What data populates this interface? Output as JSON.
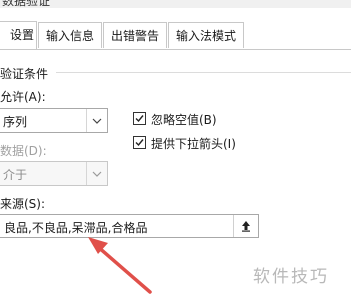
{
  "window": {
    "title": "数据验证"
  },
  "tabs": [
    {
      "label": "设置",
      "active": true
    },
    {
      "label": "输入信息",
      "active": false
    },
    {
      "label": "出错警告",
      "active": false
    },
    {
      "label": "输入法模式",
      "active": false
    }
  ],
  "validation": {
    "group_label": "验证条件",
    "allow_label": "允许(A):",
    "allow_value": "序列",
    "data_label": "数据(D):",
    "data_value": "介于",
    "ignore_blank_label": "忽略空值(B)",
    "ignore_blank_checked": true,
    "dropdown_label": "提供下拉箭头(I)",
    "dropdown_checked": true,
    "source_label": "来源(S):",
    "source_value": "良品,不良品,呆滞品,合格品"
  },
  "watermark": "软件技巧",
  "colors": {
    "annotation_arrow": "#e0504a",
    "tab_border": "#c8c8c8",
    "disabled_text": "#a0a0a0"
  },
  "icons": {
    "combo_arrow": "chevron-down-icon",
    "checkmark": "checkmark-icon",
    "collapse": "collapse-dialog-icon"
  }
}
